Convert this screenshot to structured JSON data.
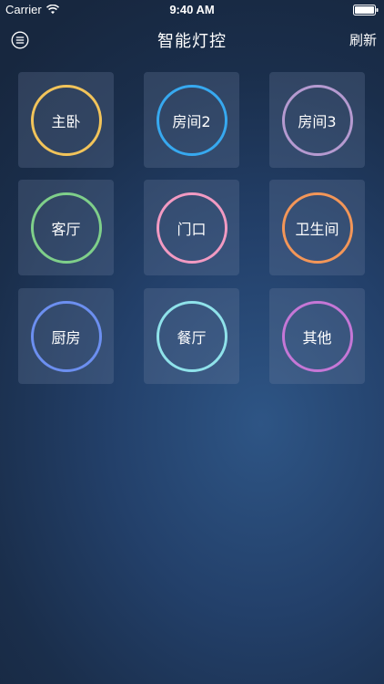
{
  "status_bar": {
    "carrier": "Carrier",
    "time": "9:40 AM"
  },
  "nav": {
    "title": "智能灯控",
    "refresh_label": "刷新",
    "menu_icon": "menu-list-icon"
  },
  "rooms": [
    {
      "label": "主卧",
      "ring_color": "#f2c45a"
    },
    {
      "label": "房间2",
      "ring_color": "#37a9f0"
    },
    {
      "label": "房间3",
      "ring_color": "#b59ad0"
    },
    {
      "label": "客厅",
      "ring_color": "#7fcf8a"
    },
    {
      "label": "门口",
      "ring_color": "#f29ac2"
    },
    {
      "label": "卫生间",
      "ring_color": "#f39658"
    },
    {
      "label": "厨房",
      "ring_color": "#6c8ff0"
    },
    {
      "label": "餐厅",
      "ring_color": "#8fe2ea"
    },
    {
      "label": "其他",
      "ring_color": "#c577d6"
    }
  ]
}
